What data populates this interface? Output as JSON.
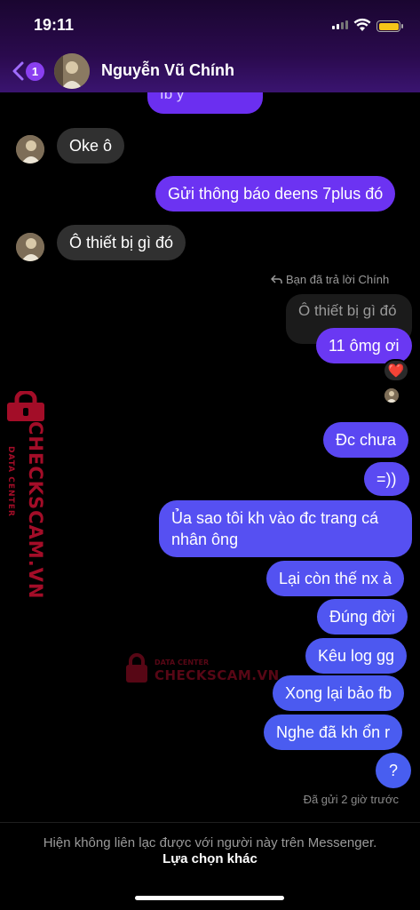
{
  "status": {
    "time": "19:11"
  },
  "header": {
    "back_badge": "1",
    "contact_name": "Nguyễn Vũ Chính"
  },
  "messages": {
    "top_partial": "fb ý",
    "m1": "Oke ô",
    "m2": "Gửi thông báo deens 7plus đó",
    "m3": "Ô thiết bị gì đó",
    "reply_note": "Bạn đã trả lời Chính",
    "quoted": "Ô thiết bị gì đó",
    "m4": "11 ômg ơi",
    "m5": "Đc chưa",
    "m6": "=))",
    "m7": "Ủa sao tôi kh vào đc trang cá nhân ông",
    "m8": "Lại còn thế nx à",
    "m9": "Đúng đời",
    "m10": "Kêu log gg",
    "m11": "Xong lại bảo fb",
    "m12": "Nghe đã kh ổn r",
    "m13": "?"
  },
  "reaction": "❤️",
  "sent_note": "Đã gửi 2 giờ trước",
  "footer": {
    "notice": "Hiện không liên lạc được với người này trên Messenger.",
    "other_option": "Lựa chọn khác"
  },
  "watermark": {
    "brand": "CHECKSCAM.VN",
    "sub": "DATA CENTER"
  },
  "colors": {
    "accent": "#8a3ff0",
    "bubble_in": "#303030",
    "bubble_purple": "#6b2ff0",
    "bubble_blue": "#4b58f0"
  }
}
